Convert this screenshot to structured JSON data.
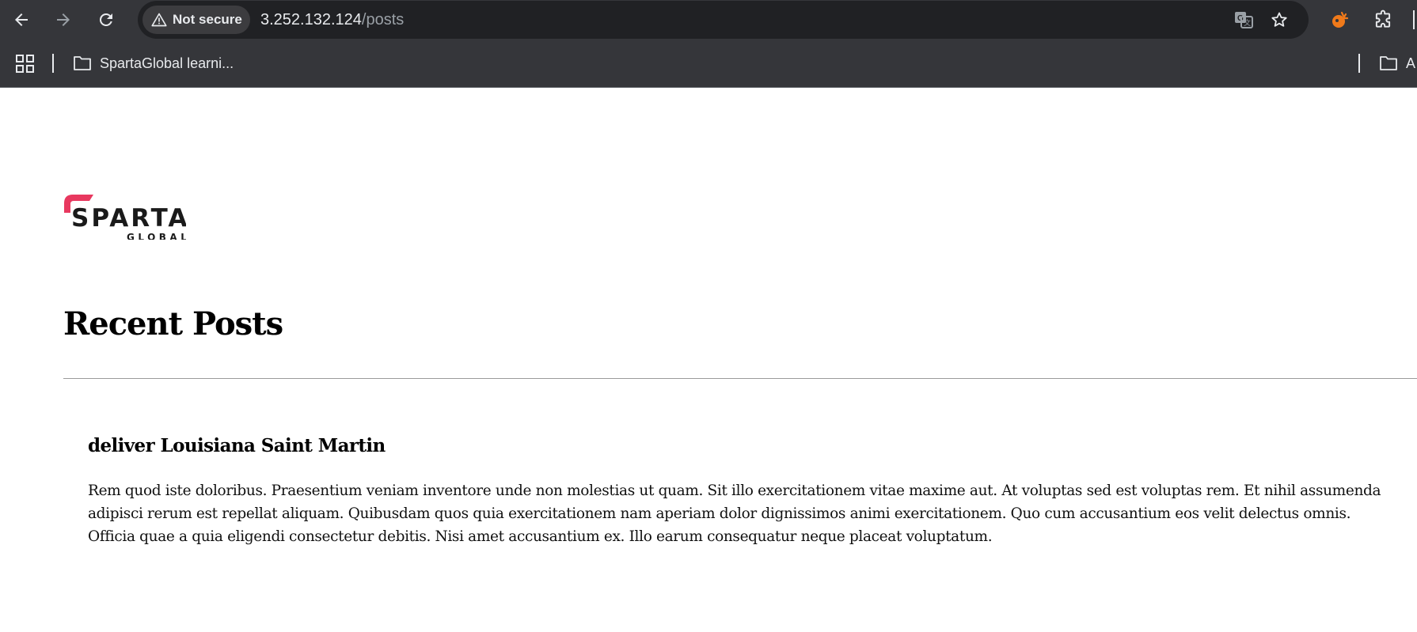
{
  "browser": {
    "security_label": "Not secure",
    "url_host": "3.252.132.124",
    "url_path": "/posts",
    "bookmarks": [
      {
        "label": "SpartaGlobal learni..."
      },
      {
        "label": "A"
      }
    ],
    "colors": {
      "chrome_bg": "#35363a",
      "omnibox_bg": "#202124",
      "extension_accent": "#f07a1a"
    }
  },
  "page": {
    "logo_text": "SPARTA",
    "logo_subtext": "GLOBAL",
    "logo_accent_color": "#e8385f",
    "title": "Recent Posts",
    "posts": [
      {
        "title": "deliver Louisiana Saint Martin",
        "body": "Rem quod iste doloribus. Praesentium veniam inventore unde non molestias ut quam. Sit illo exercitationem vitae maxime aut. At voluptas sed est voluptas rem. Et nihil assumenda adipisci rerum est repellat aliquam. Quibusdam quos quia exercitationem nam aperiam dolor dignissimos animi exercitationem. Quo cum accusantium eos velit delectus omnis. Officia quae a quia eligendi consectetur debitis. Nisi amet accusantium ex. Illo earum consequatur neque placeat voluptatum."
      }
    ]
  }
}
